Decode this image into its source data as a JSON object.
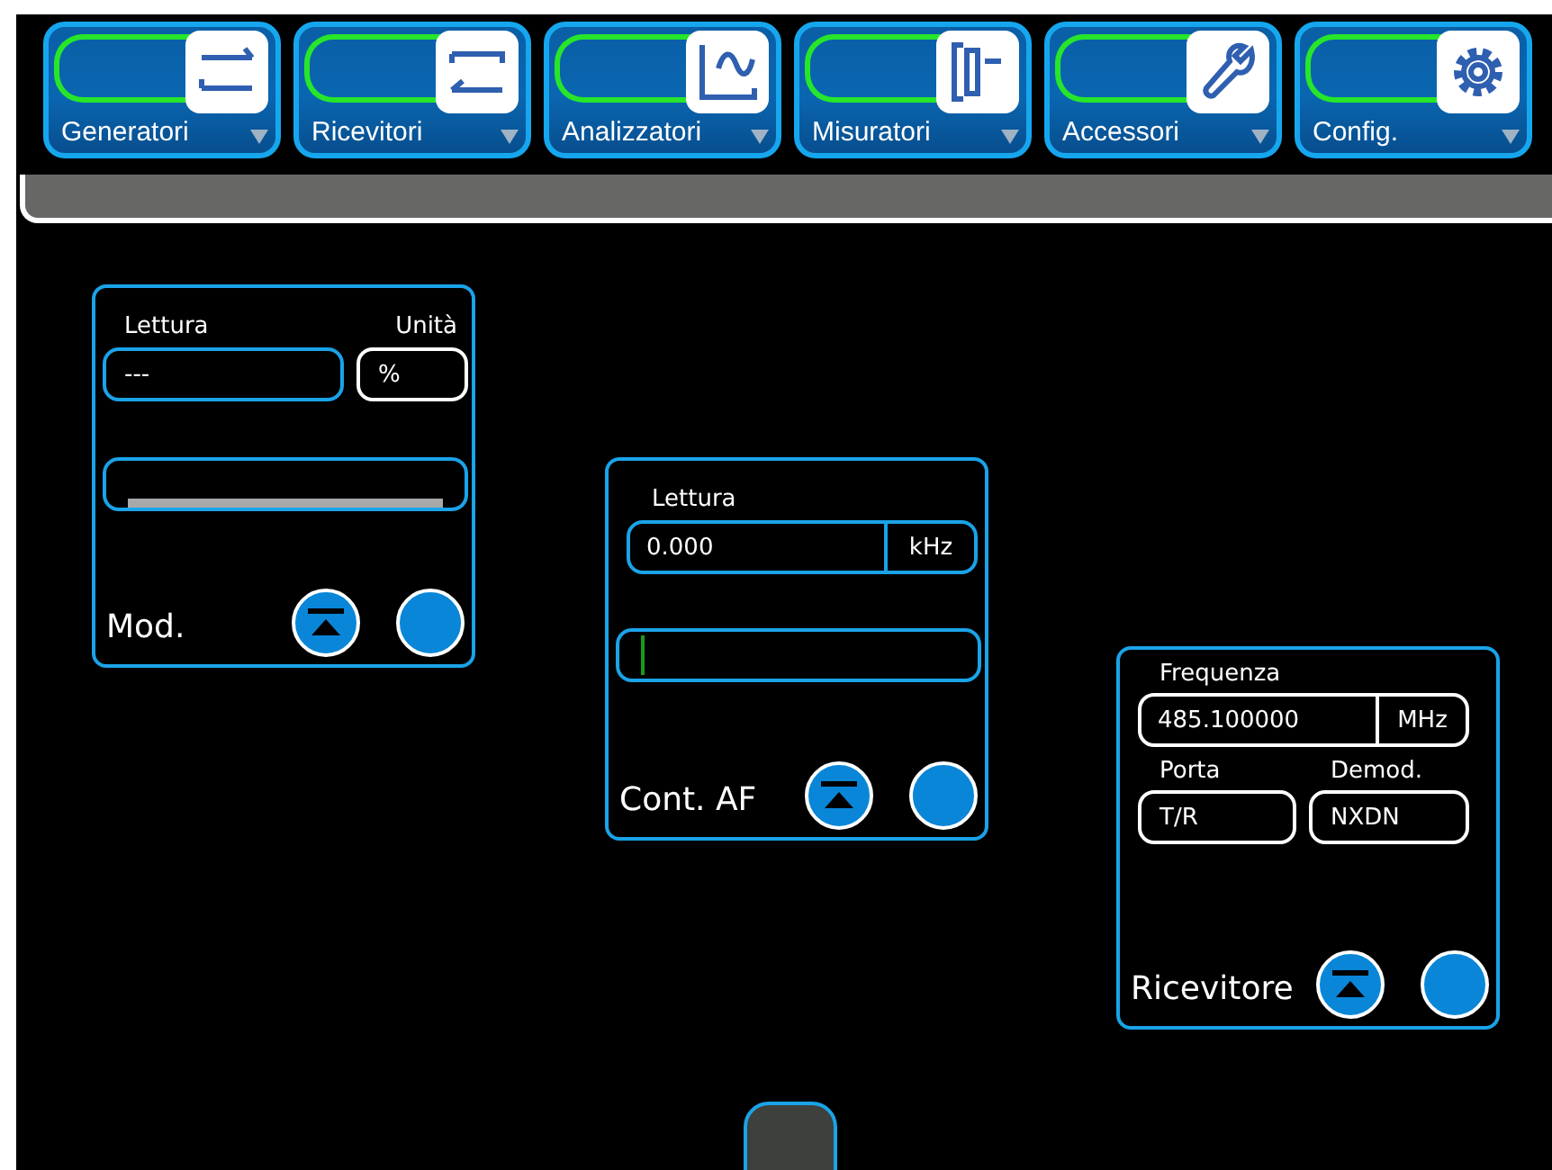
{
  "toolbar": [
    {
      "label": "Generatori"
    },
    {
      "label": "Ricevitori"
    },
    {
      "label": "Analizzatori"
    },
    {
      "label": "Misuratori"
    },
    {
      "label": "Accessori"
    },
    {
      "label": "Config."
    }
  ],
  "tiles": [
    {
      "kind": "reading",
      "title": "Mod.",
      "reading_label": "Lettura",
      "reading": "---",
      "unit_label": "Unità",
      "unit": "%",
      "meter": {
        "kind": "bar"
      }
    },
    {
      "kind": "reading_inline",
      "title": "Cont. AF",
      "reading_label": "Lettura",
      "reading": "0.000",
      "unit": "kHz",
      "meter": {
        "kind": "marker"
      }
    },
    {
      "kind": "receiver",
      "title": "Ricevitore",
      "freq_label": "Frequenza",
      "freq": "485.100000",
      "freq_unit": "MHz",
      "port_label": "Porta",
      "port": "T/R",
      "demod_label": "Demod.",
      "demod": "NXDN"
    }
  ]
}
